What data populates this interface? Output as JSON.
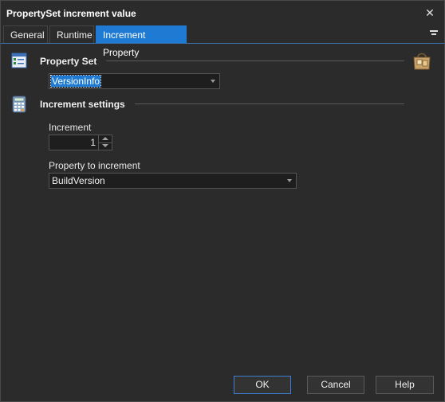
{
  "window": {
    "title": "PropertySet increment value"
  },
  "tabs": [
    {
      "label": "General"
    },
    {
      "label": "Runtime"
    },
    {
      "label": "Increment Property"
    }
  ],
  "property_set": {
    "section_title": "Property Set",
    "selected_value": "VersionInfo"
  },
  "increment_settings": {
    "section_title": "Increment settings",
    "increment_label": "Increment",
    "increment_value": "1",
    "property_label": "Property to increment",
    "property_value": "BuildVersion"
  },
  "buttons": {
    "ok": "OK",
    "cancel": "Cancel",
    "help": "Help"
  },
  "colors": {
    "accent": "#1e7ad2",
    "background": "#2b2b2b"
  },
  "icons": [
    "close-icon",
    "tab-menu-icon",
    "property-set-icon",
    "calculator-icon",
    "bag-icon"
  ]
}
